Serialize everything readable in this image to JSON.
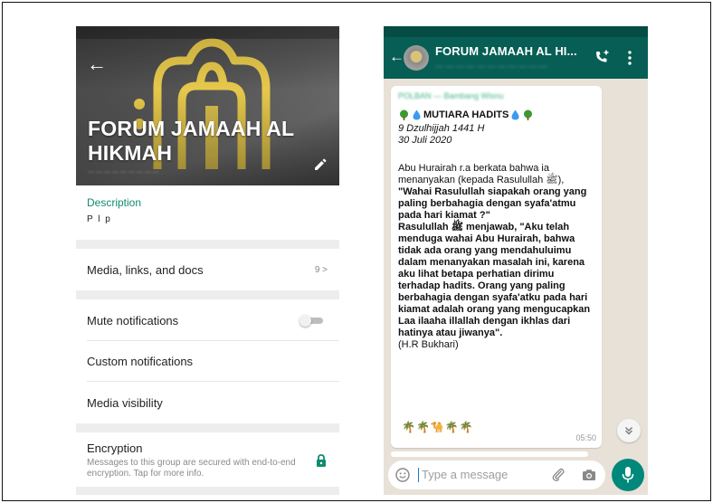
{
  "info_screen": {
    "group_name": "FORUM JAMAAH AL HIKMAH",
    "description_label": "Description",
    "description_value": "P l p",
    "media_label": "Media, links, and docs",
    "media_count": "9 >",
    "mute_label": "Mute notifications",
    "mute_enabled": false,
    "custom_notifications_label": "Custom notifications",
    "media_visibility_label": "Media visibility",
    "encryption_label": "Encryption",
    "encryption_text": "Messages to this group are secured with end-to-end encryption. Tap for more info."
  },
  "chat_screen": {
    "header_title": "FORUM JAMAAH AL HI...",
    "message": {
      "heading": "MUTIARA HADITS",
      "date_hijri": "9 Dzulhijjah 1441 H",
      "date_gregorian": "30 Juli 2020",
      "intro": "Abu Hurairah r.a berkata bahwa ia menanyakan (kepada Rasulullah ﷺ),",
      "quote1": "\"Wahai Rasulullah siapakah orang yang paling berbahagia dengan syafa'atmu pada hari kiamat ?\"",
      "reply_intro": "Rasulullah ﷺ menjawab,",
      "quote2": "\"Aku telah menduga wahai Abu Hurairah, bahwa tidak ada orang yang mendahuluimu dalam menanyakan masalah ini, karena aku lihat betapa perhatian dirimu terhadap hadits. Orang yang paling berbahagia dengan syafa'atku pada hari kiamat adalah orang yang mengucapkan Laa ilaaha illallah dengan ikhlas dari hatinya atau jiwanya\".",
      "source": "(H.R Bukhari)",
      "emojis": "🌴🌴🐪🌴🌴",
      "time": "05:50"
    },
    "input_placeholder": "Type a message"
  },
  "colors": {
    "whatsapp_green": "#075e54",
    "teal_accent": "#00897b",
    "label_green": "#0f8c6f",
    "logo_gold": "#e6c84b"
  }
}
